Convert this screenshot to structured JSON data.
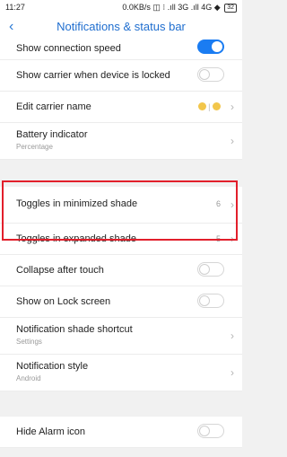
{
  "status_bar": {
    "time": "11:27",
    "indicators": "0.0KB/s ◫ ⁝ .ıll 3G .ıll 4G ◆",
    "battery": "32"
  },
  "app_bar": {
    "back_icon": "chevron-left",
    "title": "Notifications & status bar"
  },
  "colors": {
    "accent": "#1a7cf2",
    "highlight_box": "#e21f2b"
  },
  "group1": [
    {
      "label": "Show connection speed",
      "control": "toggle",
      "on": true
    },
    {
      "label": "Show carrier when device is locked",
      "control": "toggle",
      "on": false
    },
    {
      "label": "Edit carrier name",
      "value": "😊 | 😊",
      "control": "chevron"
    },
    {
      "label": "Battery indicator",
      "sub": "Percentage",
      "control": "chevron"
    }
  ],
  "group2": [
    {
      "label": "Toggles in minimized shade",
      "value": "6",
      "control": "chevron"
    },
    {
      "label": "Toggles in expanded shade",
      "value": "5",
      "control": "chevron"
    },
    {
      "label": "Collapse after touch",
      "control": "toggle",
      "on": false
    },
    {
      "label": "Show on Lock screen",
      "control": "toggle",
      "on": false
    },
    {
      "label": "Notification shade shortcut",
      "sub": "Settings",
      "control": "chevron"
    },
    {
      "label": "Notification style",
      "sub": "Android",
      "control": "chevron"
    }
  ],
  "group3": [
    {
      "label": "Hide Alarm icon",
      "control": "toggle",
      "on": false
    }
  ]
}
